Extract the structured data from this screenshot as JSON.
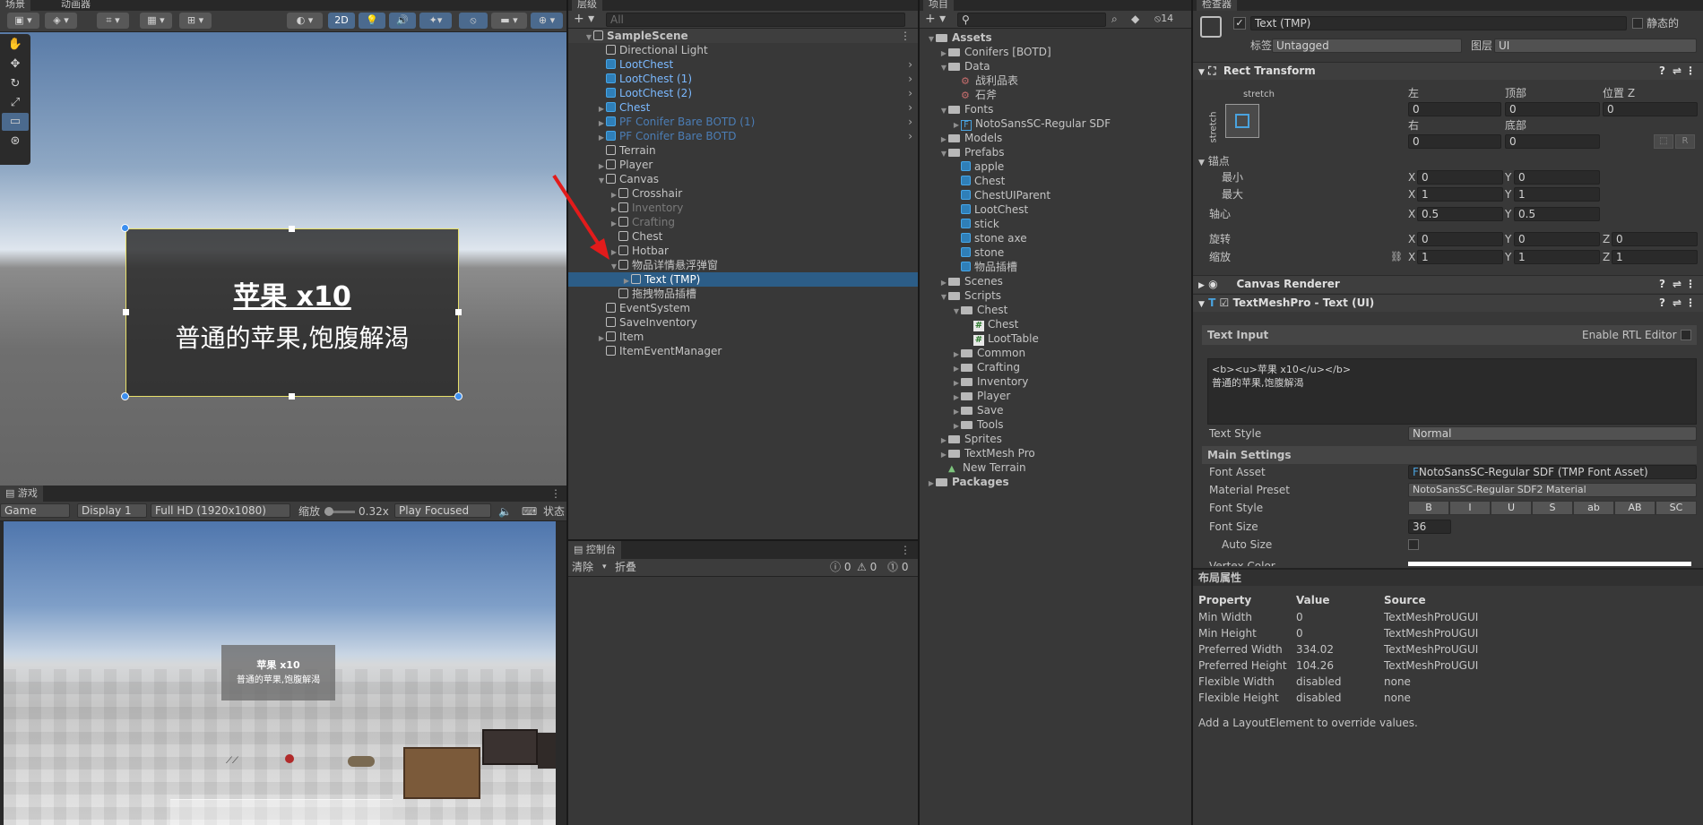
{
  "scene_view": {
    "tabs": [
      "场景",
      "动画器"
    ],
    "mode_2d": "2D",
    "ui_title": "苹果 x10",
    "ui_desc": "普通的苹果,饱腹解渴"
  },
  "game_view": {
    "tab": "游戏",
    "game_dropdown": "Game",
    "display": "Display 1",
    "resolution": "Full HD (1920x1080)",
    "scale_label": "缩放",
    "scale_value": "0.32x",
    "play_focused": "Play Focused",
    "stats": "状态",
    "popup_title": "苹果 x10",
    "popup_desc": "普通的苹果,饱腹解渴"
  },
  "hierarchy": {
    "tab": "层级",
    "search_placeholder": "All",
    "items": [
      {
        "label": "SampleScene",
        "depth": 0,
        "bold": true,
        "expand": "▼",
        "icon": "unity-icon"
      },
      {
        "label": "Directional Light",
        "depth": 1,
        "icon": "cube"
      },
      {
        "label": "LootChest",
        "depth": 1,
        "icon": "prefab",
        "style": "blue",
        "more": true
      },
      {
        "label": "LootChest (1)",
        "depth": 1,
        "icon": "prefab",
        "style": "blue",
        "more": true
      },
      {
        "label": "LootChest (2)",
        "depth": 1,
        "icon": "prefab",
        "style": "blue",
        "more": true
      },
      {
        "label": "Chest",
        "depth": 1,
        "icon": "prefab",
        "style": "blue",
        "expand": "▶",
        "more": true
      },
      {
        "label": "PF Conifer Bare BOTD (1)",
        "depth": 1,
        "icon": "prefab",
        "style": "pblue",
        "expand": "▶",
        "more": true
      },
      {
        "label": "PF Conifer Bare BOTD",
        "depth": 1,
        "icon": "prefab",
        "style": "pblue",
        "expand": "▶",
        "more": true
      },
      {
        "label": "Terrain",
        "depth": 1,
        "icon": "cube"
      },
      {
        "label": "Player",
        "depth": 1,
        "icon": "cube",
        "expand": "▶"
      },
      {
        "label": "Canvas",
        "depth": 1,
        "icon": "cube",
        "expand": "▼"
      },
      {
        "label": "Crosshair",
        "depth": 2,
        "icon": "cube",
        "expand": "▶"
      },
      {
        "label": "Inventory",
        "depth": 2,
        "icon": "cube",
        "style": "dim",
        "expand": "▶"
      },
      {
        "label": "Crafting",
        "depth": 2,
        "icon": "cube",
        "style": "dim",
        "expand": "▶"
      },
      {
        "label": "Chest",
        "depth": 2,
        "icon": "cube"
      },
      {
        "label": "Hotbar",
        "depth": 2,
        "icon": "cube",
        "expand": "▶"
      },
      {
        "label": "物品详情悬浮弹窗",
        "depth": 2,
        "icon": "cube",
        "expand": "▼"
      },
      {
        "label": "Text (TMP)",
        "depth": 3,
        "icon": "cube",
        "style": "sel",
        "expand": "▶"
      },
      {
        "label": "拖拽物品插槽",
        "depth": 2,
        "icon": "cube"
      },
      {
        "label": "EventSystem",
        "depth": 1,
        "icon": "cube"
      },
      {
        "label": "SaveInventory",
        "depth": 1,
        "icon": "cube"
      },
      {
        "label": "Item",
        "depth": 1,
        "icon": "cube",
        "expand": "▶"
      },
      {
        "label": "ItemEventManager",
        "depth": 1,
        "icon": "cube"
      }
    ]
  },
  "console": {
    "tab": "控制台",
    "clear": "清除",
    "collapse": "折叠",
    "count_info": "0",
    "count_warn": "0",
    "count_err": "0"
  },
  "project": {
    "tab": "项目",
    "hidden_count": "14",
    "items": [
      {
        "label": "Assets",
        "depth": 0,
        "type": "folder",
        "expand": "▼",
        "bold": true
      },
      {
        "label": "Conifers [BOTD]",
        "depth": 1,
        "type": "folder",
        "expand": "▶"
      },
      {
        "label": "Data",
        "depth": 1,
        "type": "folder",
        "expand": "▼"
      },
      {
        "label": "战利品表",
        "depth": 2,
        "type": "asset"
      },
      {
        "label": "石斧",
        "depth": 2,
        "type": "asset"
      },
      {
        "label": "Fonts",
        "depth": 1,
        "type": "folder",
        "expand": "▼"
      },
      {
        "label": "NotoSansSC-Regular SDF",
        "depth": 2,
        "type": "font",
        "expand": "▶"
      },
      {
        "label": "Models",
        "depth": 1,
        "type": "folder",
        "expand": "▶"
      },
      {
        "label": "Prefabs",
        "depth": 1,
        "type": "folder",
        "expand": "▼"
      },
      {
        "label": "apple",
        "depth": 2,
        "type": "prefab"
      },
      {
        "label": "Chest",
        "depth": 2,
        "type": "prefab"
      },
      {
        "label": "ChestUIParent",
        "depth": 2,
        "type": "prefab"
      },
      {
        "label": "LootChest",
        "depth": 2,
        "type": "prefab"
      },
      {
        "label": "stick",
        "depth": 2,
        "type": "prefab"
      },
      {
        "label": "stone axe",
        "depth": 2,
        "type": "prefab"
      },
      {
        "label": "stone",
        "depth": 2,
        "type": "prefab"
      },
      {
        "label": "物品插槽",
        "depth": 2,
        "type": "prefab"
      },
      {
        "label": "Scenes",
        "depth": 1,
        "type": "folder",
        "expand": "▶"
      },
      {
        "label": "Scripts",
        "depth": 1,
        "type": "folder",
        "expand": "▼"
      },
      {
        "label": "Chest",
        "depth": 2,
        "type": "folder",
        "expand": "▼"
      },
      {
        "label": "Chest",
        "depth": 3,
        "type": "script"
      },
      {
        "label": "LootTable",
        "depth": 3,
        "type": "script"
      },
      {
        "label": "Common",
        "depth": 2,
        "type": "folder",
        "expand": "▶"
      },
      {
        "label": "Crafting",
        "depth": 2,
        "type": "folder",
        "expand": "▶"
      },
      {
        "label": "Inventory",
        "depth": 2,
        "type": "folder",
        "expand": "▶"
      },
      {
        "label": "Player",
        "depth": 2,
        "type": "folder",
        "expand": "▶"
      },
      {
        "label": "Save",
        "depth": 2,
        "type": "folder",
        "expand": "▶"
      },
      {
        "label": "Tools",
        "depth": 2,
        "type": "folder",
        "expand": "▶"
      },
      {
        "label": "Sprites",
        "depth": 1,
        "type": "folder",
        "expand": "▶"
      },
      {
        "label": "TextMesh Pro",
        "depth": 1,
        "type": "folder",
        "expand": "▶"
      },
      {
        "label": "New Terrain",
        "depth": 1,
        "type": "terrain"
      },
      {
        "label": "Packages",
        "depth": 0,
        "type": "folder",
        "expand": "▶",
        "bold": true
      }
    ]
  },
  "inspector": {
    "tab": "检查器",
    "object_name": "Text (TMP)",
    "static_label": "静态的",
    "tag_label": "标签",
    "tag_value": "Untagged",
    "layer_label": "图层",
    "layer_value": "UI",
    "rect_transform": {
      "title": "Rect Transform",
      "stretch": "stretch",
      "left_label": "左",
      "left": "0",
      "top_label": "顶部",
      "top": "0",
      "posz_label": "位置 Z",
      "posz": "0",
      "right_label": "右",
      "right": "0",
      "bottom_label": "底部",
      "bottom": "0",
      "r_btn": "R",
      "anchors_label": "锚点",
      "min_label": "最小",
      "min_x": "0",
      "min_y": "0",
      "max_label": "最大",
      "max_x": "1",
      "max_y": "1",
      "pivot_label": "轴心",
      "pivot_x": "0.5",
      "pivot_y": "0.5",
      "rotation_label": "旋转",
      "rot_x": "0",
      "rot_y": "0",
      "rot_z": "0",
      "scale_label": "缩放",
      "scale_x": "1",
      "scale_y": "1",
      "scale_z": "1",
      "x": "X",
      "y": "Y",
      "z": "Z"
    },
    "canvas_renderer": "Canvas Renderer",
    "tmp": {
      "title": "TextMeshPro - Text (UI)",
      "text_input_label": "Text Input",
      "rtl_label": "Enable RTL Editor",
      "text_line1": "<b><u>苹果 x10</u></b>",
      "text_line2": "普通的苹果,饱腹解渴",
      "text_style_label": "Text Style",
      "text_style": "Normal",
      "main_settings": "Main Settings",
      "font_asset_label": "Font Asset",
      "font_asset": "NotoSansSC-Regular SDF (TMP Font Asset)",
      "material_label": "Material Preset",
      "material": "NotoSansSC-Regular SDF2 Material",
      "font_style_label": "Font Style",
      "font_styles": [
        "B",
        "I",
        "U",
        "S",
        "ab",
        "AB",
        "SC"
      ],
      "font_size_label": "Font Size",
      "font_size": "36",
      "auto_size_label": "Auto Size",
      "vertex_color_label": "Vertex Color"
    },
    "layout": {
      "title": "布局属性",
      "headers": [
        "Property",
        "Value",
        "Source"
      ],
      "rows": [
        [
          "Min Width",
          "0",
          "TextMeshProUGUI"
        ],
        [
          "Min Height",
          "0",
          "TextMeshProUGUI"
        ],
        [
          "Preferred Width",
          "334.02",
          "TextMeshProUGUI"
        ],
        [
          "Preferred Height",
          "104.26",
          "TextMeshProUGUI"
        ],
        [
          "Flexible Width",
          "disabled",
          "none"
        ],
        [
          "Flexible Height",
          "disabled",
          "none"
        ]
      ],
      "note": "Add a LayoutElement to override values."
    }
  }
}
